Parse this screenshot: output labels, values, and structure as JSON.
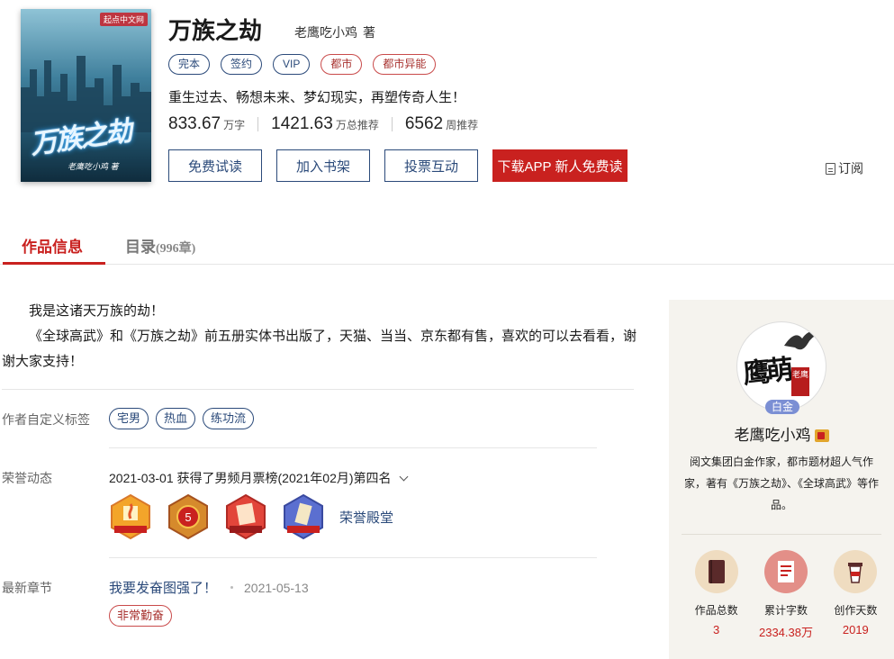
{
  "book": {
    "title": "万族之劫",
    "author": "老鹰吃小鸡",
    "author_suffix": "著",
    "cover_title": "万族之劫",
    "cover_author": "老鹰吃小鸡 著",
    "cover_brand": "起点中文网",
    "tags": [
      "完本",
      "签约",
      "VIP",
      "都市",
      "都市异能"
    ],
    "intro": "重生过去、畅想未来、梦幻现实，再塑传奇人生！",
    "stats": [
      {
        "num": "833.67",
        "unit": "万字"
      },
      {
        "num": "1421.63",
        "unit": "万总推荐"
      },
      {
        "num": "6562",
        "unit": "周推荐"
      }
    ]
  },
  "buttons": {
    "free_read": "免费试读",
    "add_shelf": "加入书架",
    "vote": "投票互动",
    "download": "下载APP 新人免费读",
    "subscribe": "订阅"
  },
  "tabs": {
    "info": "作品信息",
    "catalog": "目录",
    "catalog_count": "(996章)"
  },
  "description": {
    "line1": "我是这诸天万族的劫！",
    "line2": "《全球高武》和《万族之劫》前五册实体书出版了，天猫、当当、京东都有售，喜欢的可以去看看，谢谢大家支持！"
  },
  "custom_tags": {
    "label": "作者自定义标签",
    "items": [
      "宅男",
      "热血",
      "练功流"
    ]
  },
  "honor": {
    "label": "荣誉动态",
    "text": "2021-03-01  获得了男频月票榜(2021年02月)第四名",
    "hall": "荣誉殿堂",
    "badge_num": "5"
  },
  "latest": {
    "label": "最新章节",
    "chapter": "我要发奋图强了！",
    "date": "2021-05-13",
    "badge": "非常勤奋"
  },
  "author_card": {
    "level": "白金",
    "name": "老鹰吃小鸡",
    "bio": "阅文集团白金作家，都市题材超人气作家，著有《万族之劫》、《全球高武》等作品。",
    "avatar_text": "鹰萌",
    "seal_text": "老鹰",
    "stats": [
      {
        "label": "作品总数",
        "value": "3",
        "color": "#efdcc0"
      },
      {
        "label": "累计字数",
        "value": "2334.38万",
        "color": "#e38f88"
      },
      {
        "label": "创作天数",
        "value": "2019",
        "color": "#efdcc0"
      }
    ]
  }
}
